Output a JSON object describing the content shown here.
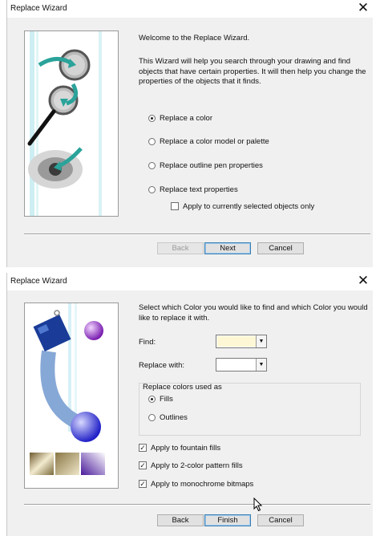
{
  "dialog1": {
    "title": "Replace Wizard",
    "close_glyph": "✕",
    "heading": "Welcome to the Replace Wizard.",
    "description": "This Wizard will help you search through your drawing and find objects that have certain properties. It will then help you change the properties of the objects that it finds.",
    "options": [
      {
        "label": "Replace a color",
        "selected": true
      },
      {
        "label": "Replace a color model or palette",
        "selected": false
      },
      {
        "label": "Replace outline pen properties",
        "selected": false
      },
      {
        "label": "Replace text properties",
        "selected": false
      }
    ],
    "selected_only_label": "Apply to currently selected objects only",
    "selected_only_checked": false,
    "buttons": {
      "back": "Back",
      "next": "Next",
      "cancel": "Cancel"
    },
    "back_enabled": false
  },
  "dialog2": {
    "title": "Replace Wizard",
    "close_glyph": "✕",
    "description": "Select which Color you would like to find and which Color you would like to replace it with.",
    "find_label": "Find:",
    "find_color": "#fdf7d5",
    "replace_label": "Replace with:",
    "replace_color": "#ffffff",
    "group_title": "Replace colors used as",
    "group_options": [
      {
        "label": "Fills",
        "selected": true
      },
      {
        "label": "Outlines",
        "selected": false
      }
    ],
    "checks": [
      {
        "label": "Apply to fountain fills",
        "checked": true
      },
      {
        "label": "Apply to 2-color pattern fills",
        "checked": true
      },
      {
        "label": "Apply to monochrome bitmaps",
        "checked": true
      }
    ],
    "buttons": {
      "back": "Back",
      "finish": "Finish",
      "cancel": "Cancel"
    }
  },
  "colors": {
    "dialog_bg": "#f0f0f0",
    "default_button_border": "#3c7fb1",
    "check_mark": "✓"
  }
}
